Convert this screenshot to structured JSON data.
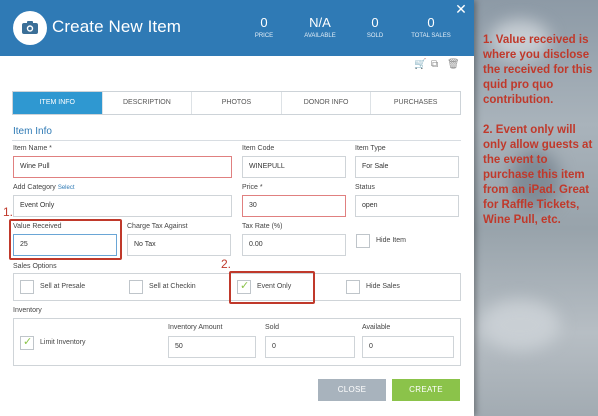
{
  "header": {
    "title": "Create New Item",
    "stats": [
      {
        "value": "0",
        "label": "PRICE"
      },
      {
        "value": "N/A",
        "label": "AVAILABLE"
      },
      {
        "value": "0",
        "label": "SOLD"
      },
      {
        "value": "0",
        "label": "TOTAL SALES"
      }
    ],
    "close_glyph": "✕"
  },
  "tabs": [
    "ITEM INFO",
    "DESCRIPTION",
    "PHOTOS",
    "DONOR INFO",
    "PURCHASES"
  ],
  "item_info": {
    "section_title": "Item Info",
    "item_name_label": "Item Name *",
    "item_name_value": "Wine Pull",
    "item_code_label": "Item Code",
    "item_code_value": "WINEPULL",
    "item_type_label": "Item Type",
    "item_type_value": "For Sale",
    "add_category_label": "Add Category",
    "add_category_link": "Select",
    "category_value": "Event Only",
    "price_label": "Price *",
    "price_value": "30",
    "status_label": "Status",
    "status_value": "open",
    "value_received_label": "Value Received",
    "value_received_value": "25",
    "charge_tax_label": "Charge Tax Against",
    "charge_tax_value": "No Tax",
    "tax_rate_label": "Tax Rate (%)",
    "tax_rate_value": "0.00",
    "hide_item_label": "Hide Item"
  },
  "sales_options": {
    "label": "Sales Options",
    "options": [
      "Sell at Presale",
      "Sell at Checkin",
      "Event Only",
      "Hide Sales"
    ]
  },
  "inventory": {
    "label": "Inventory",
    "limit_label": "Limit Inventory",
    "amount_label": "Inventory Amount",
    "amount_value": "50",
    "sold_label": "Sold",
    "sold_value": "0",
    "available_label": "Available",
    "available_value": "0"
  },
  "buttons": {
    "close": "CLOSE",
    "create": "CREATE"
  },
  "callouts": {
    "one": "1.",
    "two": "2."
  },
  "notes": [
    "1. Value received is where you disclose the received for this quid pro quo contribution.",
    "2. Event only will only allow guests at the event to purchase this item from an iPad. Great for Raffle Tickets, Wine Pull, etc."
  ],
  "colors": {
    "header": "#2f7ab5",
    "tab_active": "#2f98d1",
    "create": "#8bc34a",
    "close": "#a8b3bd",
    "annotation": "#c0392b"
  }
}
